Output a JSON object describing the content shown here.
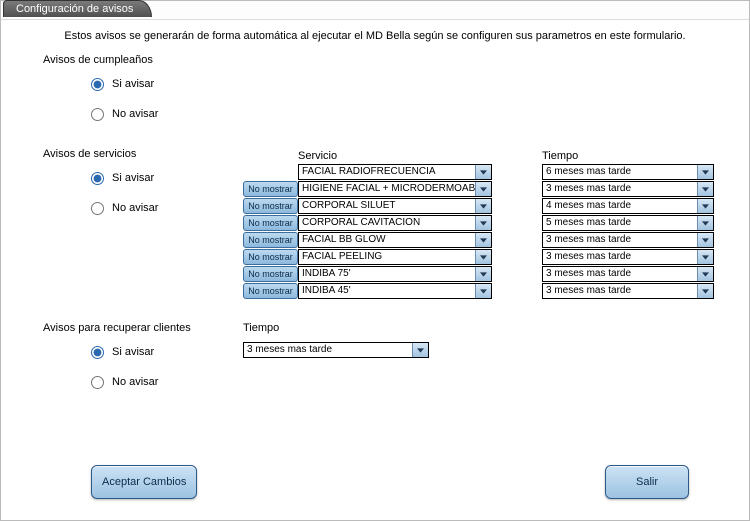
{
  "window": {
    "title": "Configuración de avisos"
  },
  "intro": "Estos avisos se generarán de forma automática al ejecutar el  MD Bella  según se configuren sus parametros en este formulario.",
  "labels": {
    "si_avisar": "Si avisar",
    "no_avisar": "No avisar",
    "no_mostrar": "No mostrar",
    "servicio": "Servicio",
    "tiempo": "Tiempo"
  },
  "birthday": {
    "title": "Avisos de cumpleaños",
    "value": "si"
  },
  "services": {
    "title": "Avisos de servicios",
    "value": "si",
    "rows": [
      {
        "servicio": "FACIAL RADIOFRECUENCIA",
        "tiempo": "6 meses mas tarde",
        "show_btn": false
      },
      {
        "servicio": "HIGIENE FACIAL + MICRODERMOABRASION",
        "tiempo": "3 meses mas tarde",
        "show_btn": true
      },
      {
        "servicio": "CORPORAL SILUET",
        "tiempo": "4 meses mas tarde",
        "show_btn": true
      },
      {
        "servicio": "CORPORAL CAVITACION",
        "tiempo": "5 meses mas tarde",
        "show_btn": true
      },
      {
        "servicio": "FACIAL BB GLOW",
        "tiempo": "3 meses mas tarde",
        "show_btn": true
      },
      {
        "servicio": "FACIAL PEELING",
        "tiempo": "3 meses mas tarde",
        "show_btn": true
      },
      {
        "servicio": "INDIBA 75'",
        "tiempo": "3 meses mas tarde",
        "show_btn": true
      },
      {
        "servicio": "INDIBA 45'",
        "tiempo": "3 meses mas tarde",
        "show_btn": true
      }
    ]
  },
  "recover": {
    "title": "Avisos para recuperar clientes",
    "value": "si",
    "tiempo": "3 meses mas tarde"
  },
  "buttons": {
    "accept": "Aceptar Cambios",
    "exit": "Salir"
  }
}
